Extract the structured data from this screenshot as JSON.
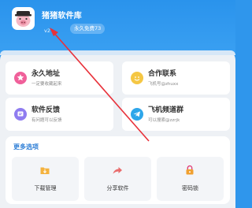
{
  "header": {
    "app_title": "猪猪软件库",
    "version": "v2",
    "badge": "永久免费73"
  },
  "cards": [
    {
      "title": "永久地址",
      "subtitle": "一定要收藏起来",
      "icon": "star-icon",
      "color": "#f0609a"
    },
    {
      "title": "合作联系",
      "subtitle": "飞机号@zhuxx",
      "icon": "smile-icon",
      "color": "#f5c744"
    },
    {
      "title": "软件反馈",
      "subtitle": "有问题可以反馈",
      "icon": "feedback-icon",
      "color": "#8f7cf0"
    },
    {
      "title": "飞机频道群",
      "subtitle": "可以搜索@zzrjk",
      "icon": "telegram-icon",
      "color": "#2ea6ea"
    }
  ],
  "more": {
    "title": "更多选项",
    "items": [
      {
        "label": "下载管理",
        "icon": "download-folder-icon",
        "color": "#f4b23e"
      },
      {
        "label": "分享软件",
        "icon": "share-icon",
        "color": "#e96c6c"
      },
      {
        "label": "密码锁",
        "icon": "lock-icon",
        "color": "#f0a030"
      }
    ]
  }
}
